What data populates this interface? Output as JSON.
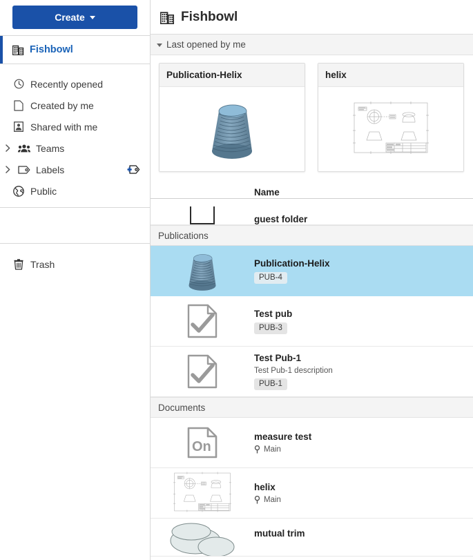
{
  "sidebar": {
    "create_label": "Create",
    "company": {
      "label": "Fishbowl",
      "icon": "building-icon"
    },
    "items": [
      {
        "label": "Recently opened",
        "icon": "clock-icon",
        "expandable": false
      },
      {
        "label": "Created by me",
        "icon": "document-icon",
        "expandable": false
      },
      {
        "label": "Shared with me",
        "icon": "shared-person-icon",
        "expandable": false
      },
      {
        "label": "Teams",
        "icon": "teams-icon",
        "expandable": true
      },
      {
        "label": "Labels",
        "icon": "label-tag-icon",
        "expandable": true,
        "trailing_icon": "add-label-icon"
      },
      {
        "label": "Public",
        "icon": "globe-icon",
        "expandable": false
      }
    ],
    "trash": {
      "label": "Trash",
      "icon": "trash-icon"
    }
  },
  "header": {
    "title": "Fishbowl",
    "icon": "building-icon"
  },
  "recently_opened": {
    "section_label": "Last opened by me",
    "cards": [
      {
        "title": "Publication-Helix",
        "thumb": "helix-part-thumb"
      },
      {
        "title": "helix",
        "thumb": "drawing-sheet-thumb"
      }
    ]
  },
  "list": {
    "column_header_name": "Name",
    "clipped_row": {
      "name": "guest folder",
      "icon": "folder-icon"
    },
    "groups": [
      {
        "label": "Publications",
        "rows": [
          {
            "name": "Publication-Helix",
            "badge": "PUB-4",
            "thumb": "helix-part-thumb",
            "selected": true
          },
          {
            "name": "Test pub",
            "badge": "PUB-3",
            "thumb": "publication-doc-icon",
            "selected": false
          },
          {
            "name": "Test Pub-1",
            "description": "Test Pub-1 description",
            "badge": "PUB-1",
            "thumb": "publication-doc-icon",
            "selected": false
          }
        ]
      },
      {
        "label": "Documents",
        "rows": [
          {
            "name": "measure test",
            "branch": "Main",
            "thumb": "onshape-doc-icon",
            "selected": false
          },
          {
            "name": "helix",
            "branch": "Main",
            "thumb": "drawing-sheet-thumb",
            "selected": false
          },
          {
            "name": "mutual trim",
            "thumb": "ellipses-thumb",
            "selected": false
          }
        ]
      }
    ]
  },
  "colors": {
    "accent_blue": "#1a51a8",
    "link_blue": "#1a63b8",
    "selection_blue": "#aadcf2",
    "section_gray": "#f4f4f4",
    "badge_gray": "#e4e4e4"
  }
}
